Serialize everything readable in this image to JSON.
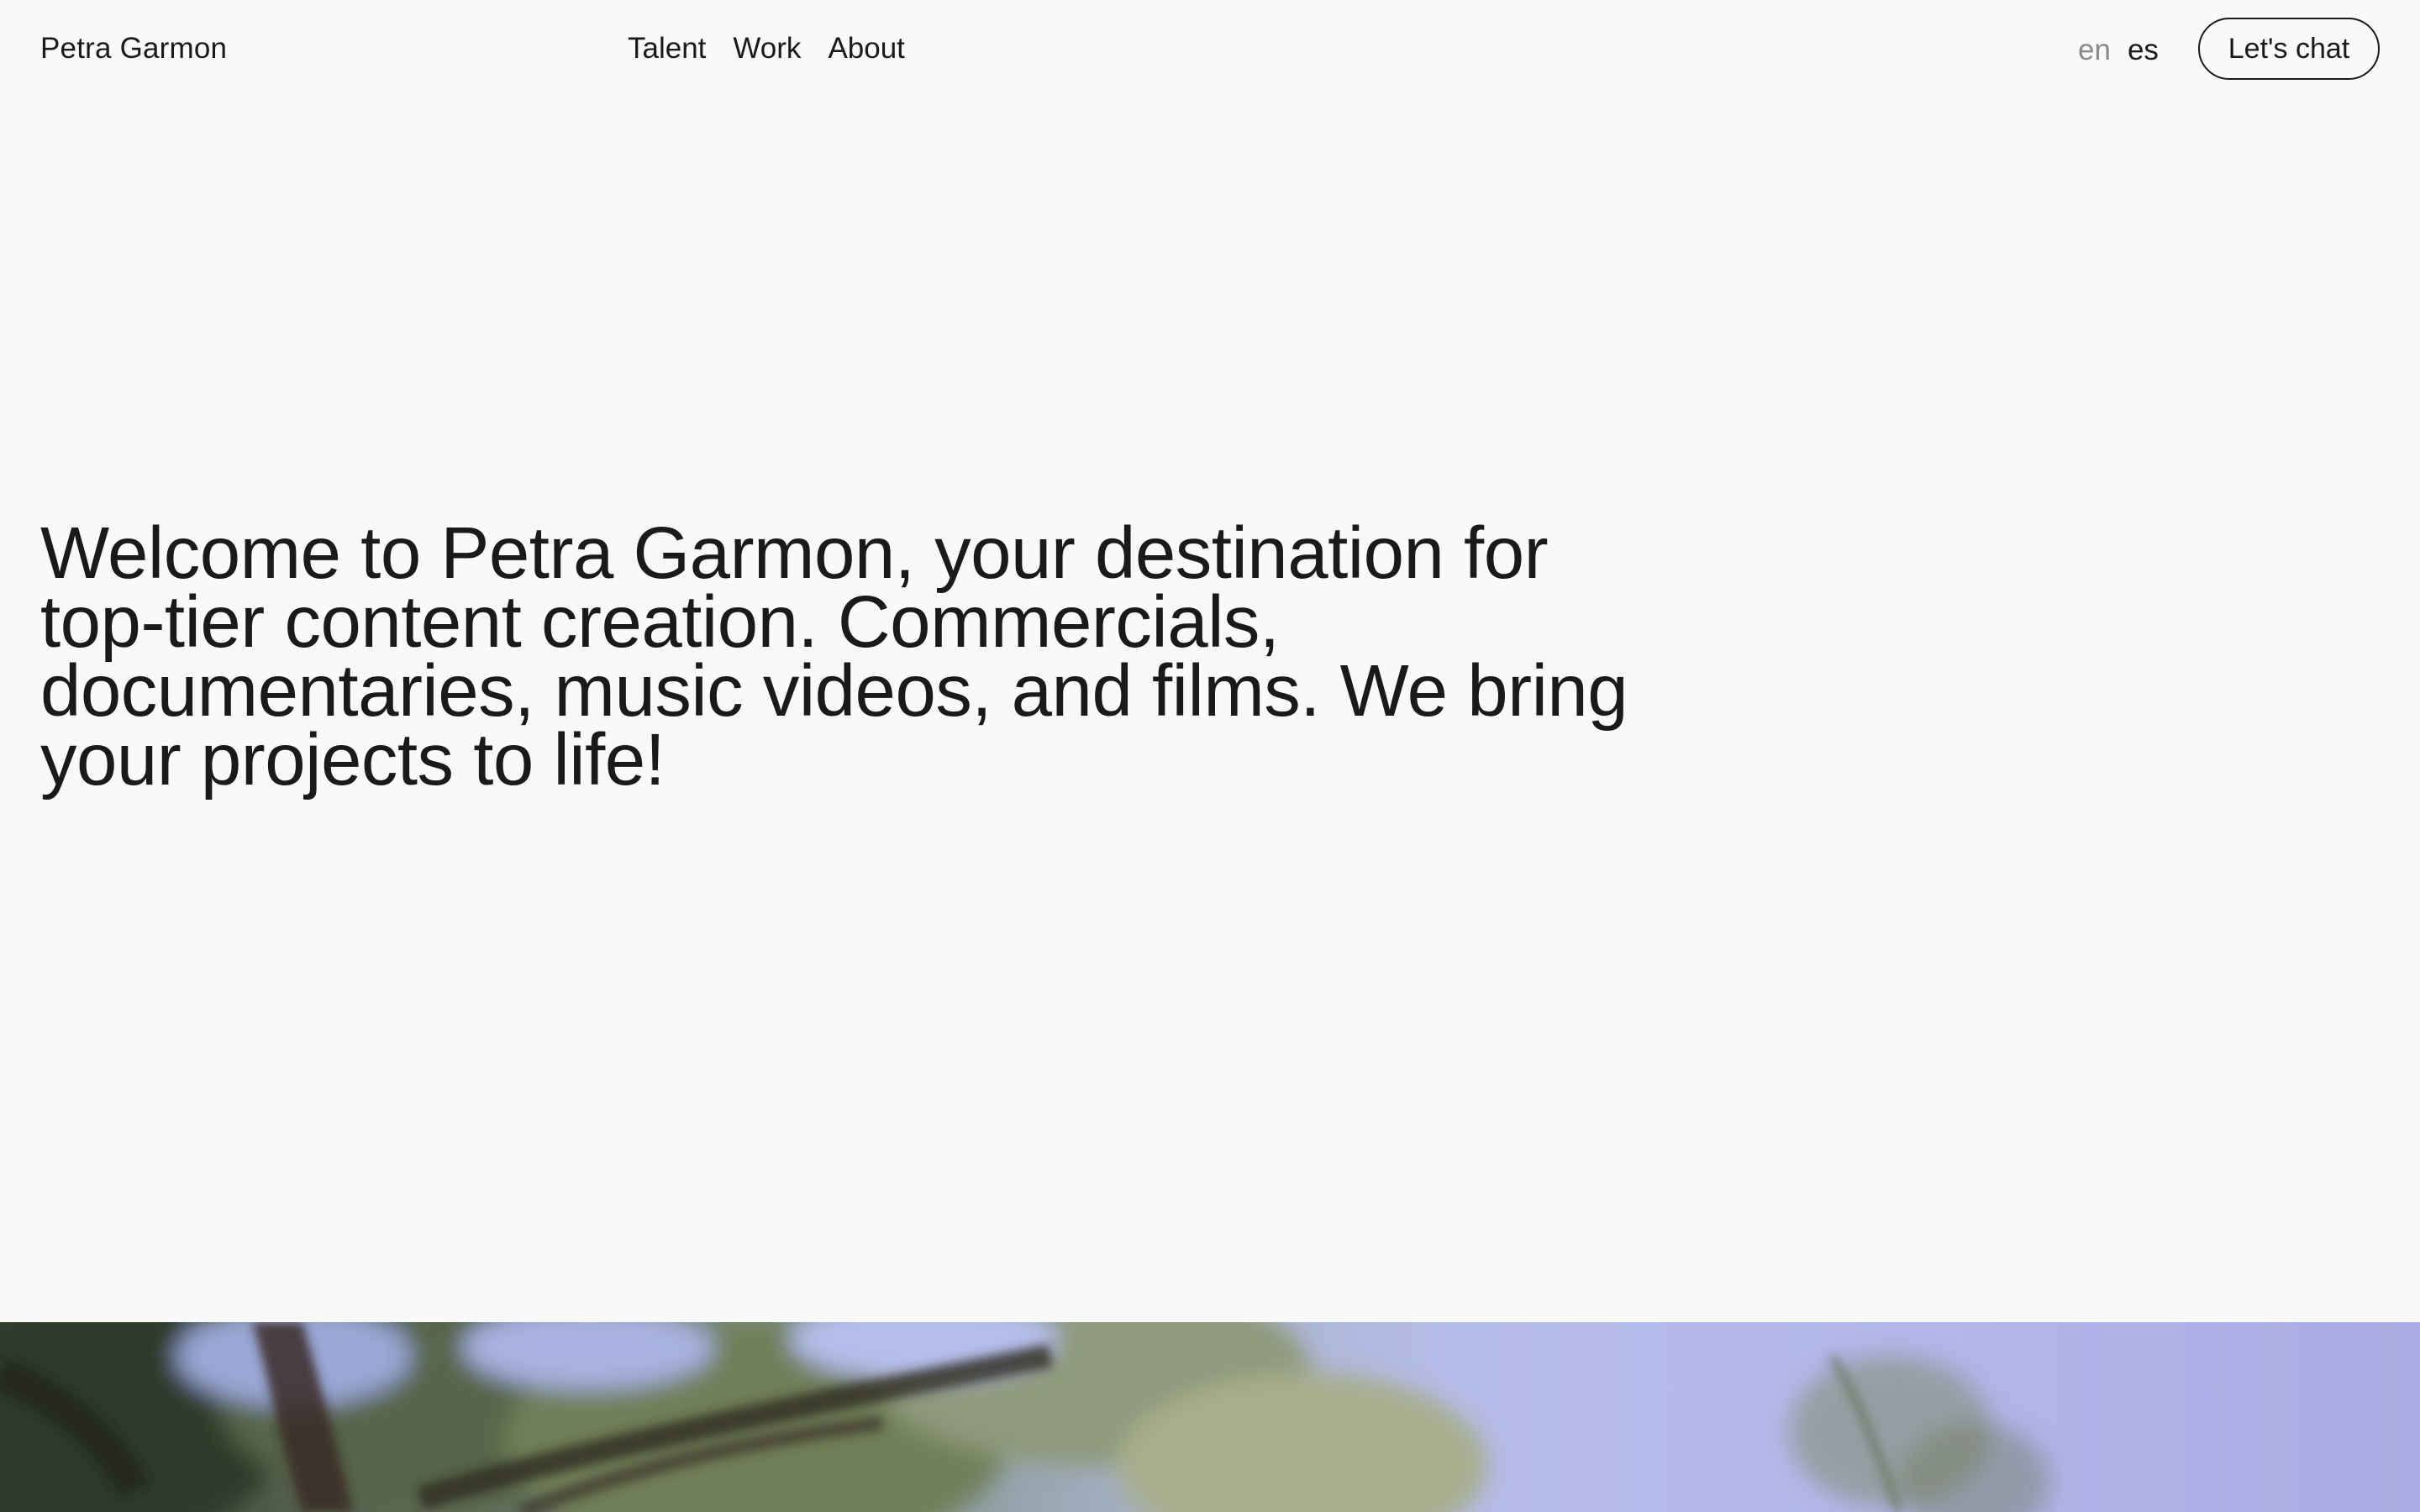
{
  "header": {
    "brand": "Petra Garmon",
    "nav": [
      {
        "label": "Talent"
      },
      {
        "label": "Work"
      },
      {
        "label": "About"
      }
    ],
    "languages": [
      {
        "label": "en",
        "active": false
      },
      {
        "label": "es",
        "active": true
      }
    ],
    "cta_label": "Let's chat"
  },
  "hero": {
    "text": "Welcome to Petra Garmon, your destination for top-tier content creation. Commercials, documentaries, music videos, and films. We bring your projects to life!"
  },
  "colors": {
    "background": "#f9f9f9",
    "text": "#1a1a1a",
    "muted_text": "#8a8a8a"
  }
}
